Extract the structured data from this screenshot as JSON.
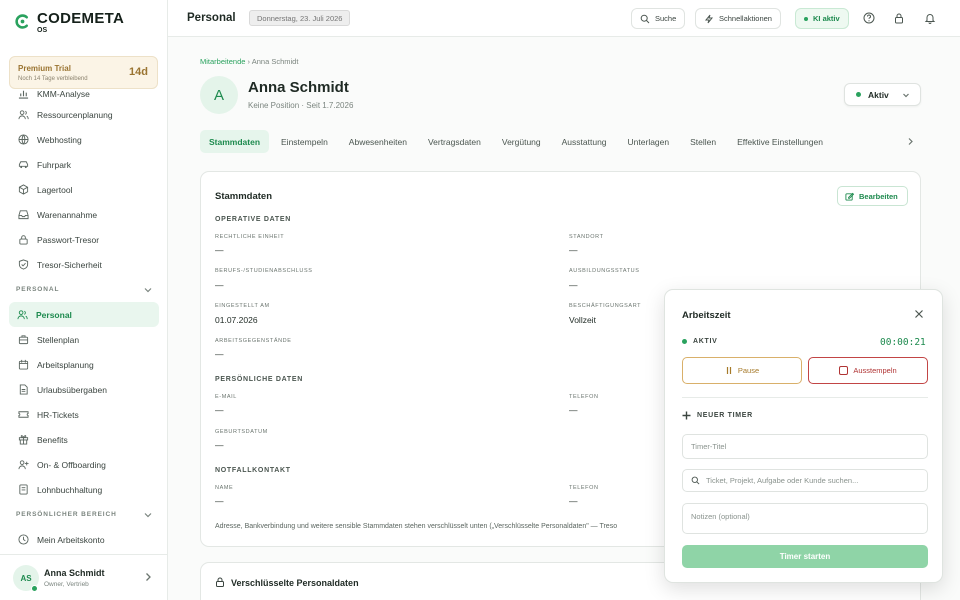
{
  "sidebar": {
    "brand": "CODEMETA",
    "brand_sub": "OS",
    "trial": {
      "title": "Premium Trial",
      "subtitle": "Noch 14 Tage verbleibend",
      "days": "14d"
    },
    "items_top": [
      {
        "label": "KMM-Analyse",
        "icon": "chart-icon"
      },
      {
        "label": "Ressourcenplanung",
        "icon": "users-icon"
      },
      {
        "label": "Webhosting",
        "icon": "globe-icon"
      },
      {
        "label": "Fuhrpark",
        "icon": "car-icon"
      },
      {
        "label": "Lagertool",
        "icon": "box-icon"
      },
      {
        "label": "Warenannahme",
        "icon": "inbox-icon"
      },
      {
        "label": "Passwort-Tresor",
        "icon": "lock-icon"
      },
      {
        "label": "Tresor-Sicherheit",
        "icon": "shield-icon"
      }
    ],
    "section_personal": "PERSONAL",
    "items_personal": [
      {
        "label": "Personal",
        "icon": "users-icon",
        "active": true
      },
      {
        "label": "Stellenplan",
        "icon": "briefcase-icon"
      },
      {
        "label": "Arbeitsplanung",
        "icon": "calendar-icon"
      },
      {
        "label": "Urlaubsübergaben",
        "icon": "document-icon"
      },
      {
        "label": "HR-Tickets",
        "icon": "ticket-icon"
      },
      {
        "label": "Benefits",
        "icon": "gift-icon"
      },
      {
        "label": "On- & Offboarding",
        "icon": "user-plus-icon"
      },
      {
        "label": "Lohnbuchhaltung",
        "icon": "file-icon"
      }
    ],
    "section_private": "PERSÖNLICHER BEREICH",
    "items_private": [
      {
        "label": "Mein Arbeitskonto",
        "icon": "clock-icon"
      }
    ],
    "user": {
      "initials": "AS",
      "name": "Anna Schmidt",
      "role": "Owner, Vertrieb"
    }
  },
  "topbar": {
    "title": "Personal",
    "date": "Donnerstag, 23. Juli 2026",
    "search": "Suche",
    "quick": "Schnellaktionen",
    "ki": "KI aktiv"
  },
  "breadcrumb": {
    "parent": "Mitarbeitende",
    "sep": "›",
    "current": "Anna Schmidt"
  },
  "profile": {
    "initial": "A",
    "name": "Anna Schmidt",
    "subtitle": "Keine Position · Seit 1.7.2026",
    "status": "Aktiv"
  },
  "tabs": [
    "Stammdaten",
    "Einstempeln",
    "Abwesenheiten",
    "Vertragsdaten",
    "Vergütung",
    "Ausstattung",
    "Unterlagen",
    "Stellen",
    "Effektive Einstellungen"
  ],
  "stammdaten": {
    "title": "Stammdaten",
    "edit": "Bearbeiten",
    "sections": {
      "operative": "OPERATIVE DATEN",
      "personal": "PERSÖNLICHE DATEN",
      "emergency": "NOTFALLKONTAKT"
    },
    "fields": {
      "einheit_label": "RECHTLICHE EINHEIT",
      "einheit_value": "—",
      "standort_label": "STANDORT",
      "standort_value": "—",
      "abschluss_label": "BERUFS-/STUDIENABSCHLUSS",
      "abschluss_value": "—",
      "ausbildung_label": "AUSBILDUNGSSTATUS",
      "ausbildung_value": "—",
      "eingestellt_label": "EINGESTELLT AM",
      "eingestellt_value": "01.07.2026",
      "beschaeftigung_label": "BESCHÄFTIGUNGSART",
      "beschaeftigung_value": "Vollzeit",
      "gegenstaende_label": "ARBEITSGEGENSTÄNDE",
      "gegenstaende_value": "—",
      "email_label": "E-MAIL",
      "email_value": "—",
      "telefon_label": "TELEFON",
      "telefon_value": "—",
      "geburtsdatum_label": "GEBURTSDATUM",
      "geburtsdatum_value": "—",
      "notname_label": "NAME",
      "notname_value": "—",
      "nottelefon_label": "TELEFON",
      "nottelefon_value": "—"
    },
    "note": "Adresse, Bankverbindung und weitere sensible Stammdaten stehen verschlüsselt unten („Verschlüsselte Personaldaten\" — Treso"
  },
  "encrypted": {
    "title": "Verschlüsselte Personaldaten"
  },
  "timer": {
    "title": "Arbeitszeit",
    "status": "AKTIV",
    "clock": "00:00:21",
    "pause": "Pause",
    "stop": "Ausstempeln",
    "new_timer": "NEUER TIMER",
    "title_placeholder": "Timer-Titel",
    "search_placeholder": "Ticket, Projekt, Aufgabe oder Kunde suchen...",
    "notes_placeholder": "Notizen (optional)",
    "start": "Timer starten"
  },
  "colors": {
    "accent": "#1d8a4e",
    "accent_light": "#e6f5ec",
    "warning": "#a67a2a",
    "danger": "#b03434"
  }
}
